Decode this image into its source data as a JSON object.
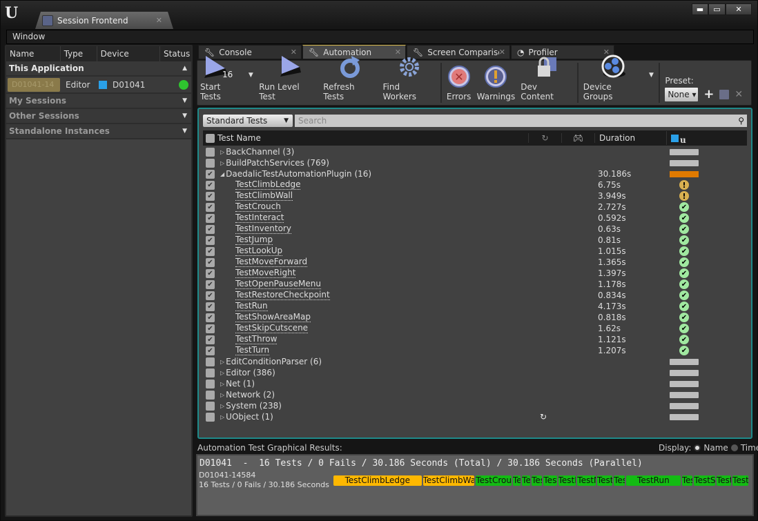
{
  "window": {
    "tab_title": "Session Frontend",
    "menu": [
      "Window"
    ]
  },
  "sessions": {
    "columns": [
      "Name",
      "Type",
      "Device",
      "Status"
    ],
    "sections": [
      {
        "label": "This Application",
        "expanded": true
      },
      {
        "label": "My Sessions",
        "expanded": false
      },
      {
        "label": "Other Sessions",
        "expanded": false
      },
      {
        "label": "Standalone Instances",
        "expanded": false
      }
    ],
    "instance": {
      "name": "D01041-14",
      "type": "Editor",
      "device": "D01041",
      "status_color": "#2fc42f"
    }
  },
  "tabs": [
    {
      "label": "Console",
      "icon": "wrench-icon",
      "active": false
    },
    {
      "label": "Automation",
      "icon": "wrench-icon",
      "active": true
    },
    {
      "label": "Screen Comparison",
      "icon": "wrench-icon",
      "active": false
    },
    {
      "label": "Profiler",
      "icon": "profiler-icon",
      "active": false
    }
  ],
  "toolbar": {
    "start_tests": "Start Tests",
    "start_count": "16",
    "run_level_test": "Run Level Test",
    "refresh_tests": "Refresh Tests",
    "find_workers": "Find Workers",
    "errors": "Errors",
    "warnings": "Warnings",
    "dev_content": "Dev Content",
    "device_groups": "Device Groups",
    "preset_label": "Preset:",
    "preset_value": "None"
  },
  "filter": {
    "selected": "Standard Tests",
    "search_placeholder": "Search"
  },
  "table": {
    "headers": {
      "name": "Test Name",
      "duration": "Duration"
    },
    "rows": [
      {
        "name": "BackChannel (3)",
        "type": "group",
        "checked": false,
        "expanded": false,
        "duration": "",
        "status": "none"
      },
      {
        "name": "BuildPatchServices (769)",
        "type": "group",
        "checked": false,
        "expanded": false,
        "duration": "",
        "status": "none"
      },
      {
        "name": "DaedalicTestAutomationPlugin (16)",
        "type": "group",
        "checked": true,
        "expanded": true,
        "duration": "30.186s",
        "status": "progress"
      },
      {
        "name": "TestClimbLedge",
        "type": "leaf",
        "checked": true,
        "duration": "6.75s",
        "status": "warning"
      },
      {
        "name": "TestClimbWall",
        "type": "leaf",
        "checked": true,
        "duration": "3.949s",
        "status": "warning"
      },
      {
        "name": "TestCrouch",
        "type": "leaf",
        "checked": true,
        "duration": "2.727s",
        "status": "success"
      },
      {
        "name": "TestInteract",
        "type": "leaf",
        "checked": true,
        "duration": "0.592s",
        "status": "success"
      },
      {
        "name": "TestInventory",
        "type": "leaf",
        "checked": true,
        "duration": "0.63s",
        "status": "success"
      },
      {
        "name": "TestJump",
        "type": "leaf",
        "checked": true,
        "duration": "0.81s",
        "status": "success"
      },
      {
        "name": "TestLookUp",
        "type": "leaf",
        "checked": true,
        "duration": "1.015s",
        "status": "success"
      },
      {
        "name": "TestMoveForward",
        "type": "leaf",
        "checked": true,
        "duration": "1.365s",
        "status": "success"
      },
      {
        "name": "TestMoveRight",
        "type": "leaf",
        "checked": true,
        "duration": "1.397s",
        "status": "success"
      },
      {
        "name": "TestOpenPauseMenu",
        "type": "leaf",
        "checked": true,
        "duration": "1.178s",
        "status": "success"
      },
      {
        "name": "TestRestoreCheckpoint",
        "type": "leaf",
        "checked": true,
        "duration": "0.834s",
        "status": "success"
      },
      {
        "name": "TestRun",
        "type": "leaf",
        "checked": true,
        "duration": "4.173s",
        "status": "success"
      },
      {
        "name": "TestShowAreaMap",
        "type": "leaf",
        "checked": true,
        "duration": "0.818s",
        "status": "success"
      },
      {
        "name": "TestSkipCutscene",
        "type": "leaf",
        "checked": true,
        "duration": "1.62s",
        "status": "success"
      },
      {
        "name": "TestThrow",
        "type": "leaf",
        "checked": true,
        "duration": "1.121s",
        "status": "success"
      },
      {
        "name": "TestTurn",
        "type": "leaf",
        "checked": true,
        "duration": "1.207s",
        "status": "success"
      },
      {
        "name": "EditConditionParser (6)",
        "type": "group",
        "checked": false,
        "expanded": false,
        "duration": "",
        "status": "none"
      },
      {
        "name": "Editor (386)",
        "type": "group",
        "checked": false,
        "expanded": false,
        "duration": "",
        "status": "none"
      },
      {
        "name": "Net (1)",
        "type": "group",
        "checked": false,
        "expanded": false,
        "duration": "",
        "status": "none"
      },
      {
        "name": "Network (2)",
        "type": "group",
        "checked": false,
        "expanded": false,
        "duration": "",
        "status": "none"
      },
      {
        "name": "System (238)",
        "type": "group",
        "checked": false,
        "expanded": false,
        "duration": "",
        "status": "none"
      },
      {
        "name": "UObject (1)",
        "type": "group",
        "checked": false,
        "expanded": false,
        "duration": "",
        "status": "none",
        "smoke": true
      }
    ]
  },
  "results": {
    "label": "Automation Test Graphical Results:",
    "display_label": "Display:",
    "display_options": [
      {
        "label": "Name",
        "selected": true
      },
      {
        "label": "Time",
        "selected": false
      }
    ],
    "summary": "D01041  -  16 Tests / 0 Fails / 30.186 Seconds (Total) / 30.186 Seconds (Parallel)",
    "device_id": "D01041-14584",
    "device_summary": "16 Tests / 0 Fails / 30.186 Seconds",
    "bars": [
      {
        "label": "TestClimbLedge",
        "seconds": 6.75,
        "status": "warning"
      },
      {
        "label": "TestClimbWall",
        "seconds": 3.949,
        "status": "warning"
      },
      {
        "label": "TestCrouch",
        "seconds": 2.727,
        "status": "success"
      },
      {
        "label": "TestInteract",
        "seconds": 0.592,
        "status": "success"
      },
      {
        "label": "TestInventory",
        "seconds": 0.63,
        "status": "success"
      },
      {
        "label": "TestJump",
        "seconds": 0.81,
        "status": "success"
      },
      {
        "label": "TestLookUp",
        "seconds": 1.015,
        "status": "success"
      },
      {
        "label": "TestMoveForward",
        "seconds": 1.365,
        "status": "success"
      },
      {
        "label": "TestMoveRight",
        "seconds": 1.397,
        "status": "success"
      },
      {
        "label": "TestOpenPauseMenu",
        "seconds": 1.178,
        "status": "success"
      },
      {
        "label": "TestRestoreCheckpoint",
        "seconds": 0.834,
        "status": "success"
      },
      {
        "label": "TestRun",
        "seconds": 4.173,
        "status": "success"
      },
      {
        "label": "TestShowAreaMap",
        "seconds": 0.818,
        "status": "success"
      },
      {
        "label": "TestSkipCutscene",
        "seconds": 1.62,
        "status": "success"
      },
      {
        "label": "TestThrow",
        "seconds": 1.121,
        "status": "success"
      },
      {
        "label": "TestTurn",
        "seconds": 1.207,
        "status": "success"
      }
    ],
    "colors": {
      "warning": "#ffb800",
      "success": "#13bb13"
    }
  }
}
